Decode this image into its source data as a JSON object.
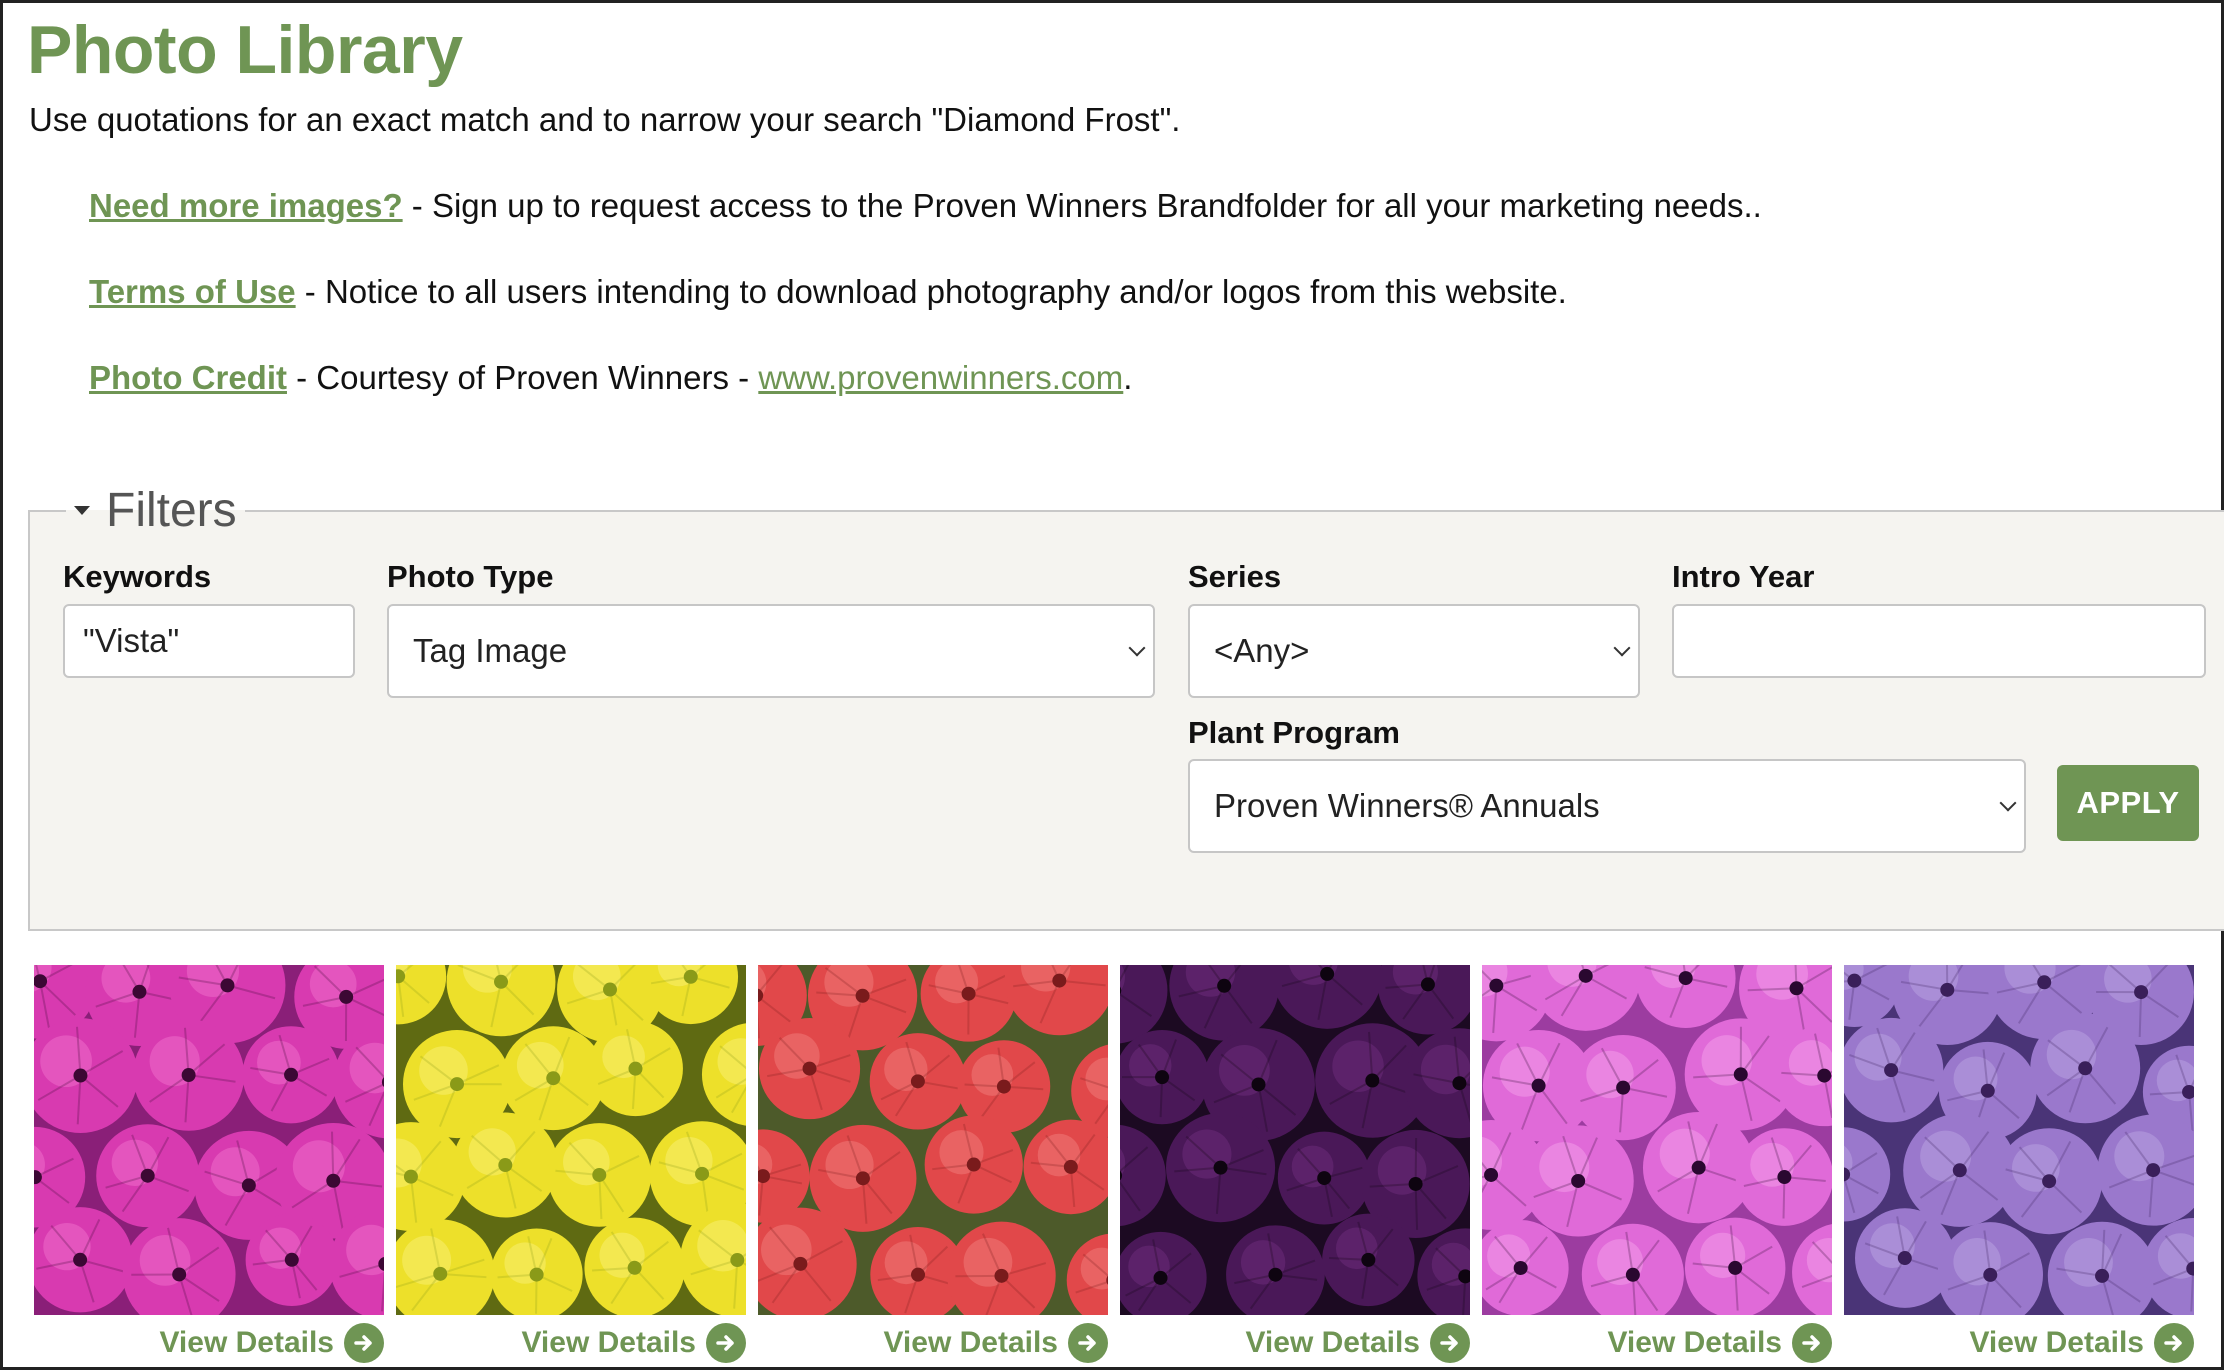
{
  "page": {
    "title": "Photo Library",
    "intro": "Use quotations for an exact match and to narrow your search \"Diamond Frost\"."
  },
  "info_links": [
    {
      "link_text": "Need more images?",
      "rest": " - Sign up to request access to the Proven Winners Brandfolder for all your marketing needs.."
    },
    {
      "link_text": "Terms of Use",
      "rest": " - Notice to all users intending to download photography and/or logos from this website."
    },
    {
      "link_text": "Photo Credit",
      "rest": " - Courtesy of Proven Winners - ",
      "url_text": "www.provenwinners.com",
      "after": "."
    }
  ],
  "filters": {
    "legend": "Filters",
    "keywords": {
      "label": "Keywords",
      "value": "\"Vista\""
    },
    "photo_type": {
      "label": "Photo Type",
      "selected": "Tag Image"
    },
    "series": {
      "label": "Series",
      "selected": "<Any>"
    },
    "intro_year": {
      "label": "Intro Year",
      "value": ""
    },
    "plant_program": {
      "label": "Plant Program",
      "selected": "Proven Winners® Annuals"
    },
    "apply_label": "APPLY"
  },
  "gallery": {
    "details_label": "View Details",
    "cards": [
      {
        "color": "magenta",
        "bg": "#8a1f78",
        "petal": "#d83ab0",
        "light": "#ee6ccb",
        "center": "#3c0834"
      },
      {
        "color": "yellow",
        "bg": "#5f6a12",
        "petal": "#ede02a",
        "light": "#f7ef70",
        "center": "#8a9a18"
      },
      {
        "color": "red",
        "bg": "#4d5a2a",
        "petal": "#e1484a",
        "light": "#f07a78",
        "center": "#7a1b1c"
      },
      {
        "color": "dark-purple",
        "bg": "#1c0a22",
        "petal": "#4a1858",
        "light": "#6b2c7a",
        "center": "#0e0410"
      },
      {
        "color": "pink",
        "bg": "#9c3ca0",
        "petal": "#e06ad8",
        "light": "#f29be9",
        "center": "#2a0830"
      },
      {
        "color": "lavender",
        "bg": "#4a3477",
        "petal": "#9a78cc",
        "light": "#b8a0e0",
        "center": "#3a1f5a"
      }
    ]
  },
  "accent_color": "#6f9554"
}
